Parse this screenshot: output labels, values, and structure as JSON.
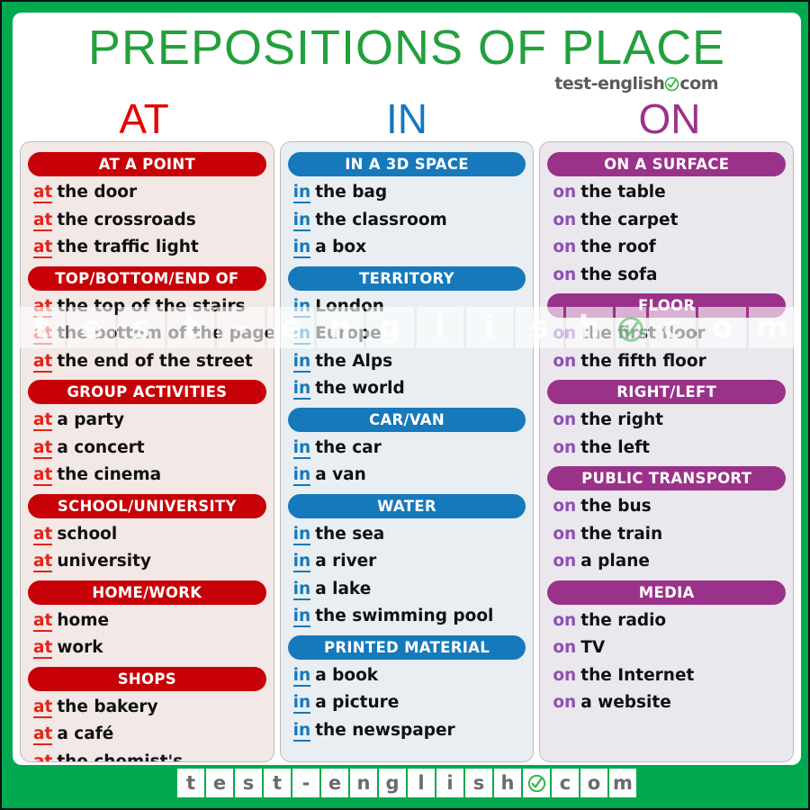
{
  "poster": {
    "title": "PREPOSITIONS OF PLACE",
    "brand": {
      "left_text": "test-english",
      "check_icon": "green-check-circle-icon",
      "right_text": "com"
    },
    "colors": {
      "frame_green": "#00a94f",
      "title_green": "#22a03c",
      "at_red": "#c80008",
      "at_letter_red": "#e50000",
      "in_blue": "#1679bc",
      "on_purple": "#9b3289",
      "at_panel_bg": "#f2e8e6",
      "in_panel_bg": "#e8eef1",
      "on_panel_bg": "#eae8ed"
    }
  },
  "columns": [
    {
      "letter": "AT",
      "key": "at",
      "preposition": "at",
      "sections": [
        {
          "heading": "AT A POINT",
          "items": [
            "the door",
            "the crossroads",
            "the traffic light"
          ]
        },
        {
          "heading": "TOP/BOTTOM/END OF",
          "items": [
            "the top  of the stairs",
            "the bottom of the page",
            "the end of the street"
          ]
        },
        {
          "heading": "GROUP ACTIVITIES",
          "items": [
            "a party",
            "a concert",
            "the cinema"
          ]
        },
        {
          "heading": "SCHOOL/UNIVERSITY",
          "items": [
            "school",
            "university"
          ]
        },
        {
          "heading": "HOME/WORK",
          "items": [
            "home",
            "work"
          ]
        },
        {
          "heading": "SHOPS",
          "items": [
            "the bakery",
            "a café",
            "the chemist's"
          ]
        }
      ]
    },
    {
      "letter": "IN",
      "key": "in",
      "preposition": "in",
      "sections": [
        {
          "heading": "IN A 3D SPACE",
          "items": [
            "the bag",
            "the classroom",
            "a box"
          ]
        },
        {
          "heading": "TERRITORY",
          "items": [
            "London",
            "Europe",
            "the Alps",
            "the world"
          ]
        },
        {
          "heading": "CAR/VAN",
          "items": [
            "the car",
            "a van"
          ]
        },
        {
          "heading": "WATER",
          "items": [
            "the sea",
            "a river",
            "a lake",
            "the swimming pool"
          ]
        },
        {
          "heading": "PRINTED MATERIAL",
          "items": [
            "a book",
            "a picture",
            "the newspaper"
          ]
        }
      ]
    },
    {
      "letter": "ON",
      "key": "on",
      "preposition": "on",
      "sections": [
        {
          "heading": "ON A SURFACE",
          "items": [
            "the table",
            "the carpet",
            "the roof",
            "the sofa"
          ]
        },
        {
          "heading": "FLOOR",
          "items": [
            "the first floor",
            "the fifth floor"
          ]
        },
        {
          "heading": "RIGHT/LEFT",
          "items": [
            "the right",
            "the left"
          ]
        },
        {
          "heading": "PUBLIC TRANSPORT",
          "items": [
            "the bus",
            "the train",
            "a plane"
          ]
        },
        {
          "heading": "MEDIA",
          "items": [
            "the radio",
            "TV",
            "the Internet",
            "a website"
          ]
        }
      ]
    }
  ],
  "watermark": {
    "characters": [
      "t",
      "e",
      "s",
      "t",
      "-",
      "e",
      "n",
      "g",
      "l",
      "i",
      "s",
      "h",
      "check",
      "c",
      "o",
      "m"
    ]
  },
  "footer": {
    "characters": [
      "t",
      "e",
      "s",
      "t",
      "-",
      "e",
      "n",
      "g",
      "l",
      "i",
      "s",
      "h",
      "check",
      "c",
      "o",
      "m"
    ]
  }
}
